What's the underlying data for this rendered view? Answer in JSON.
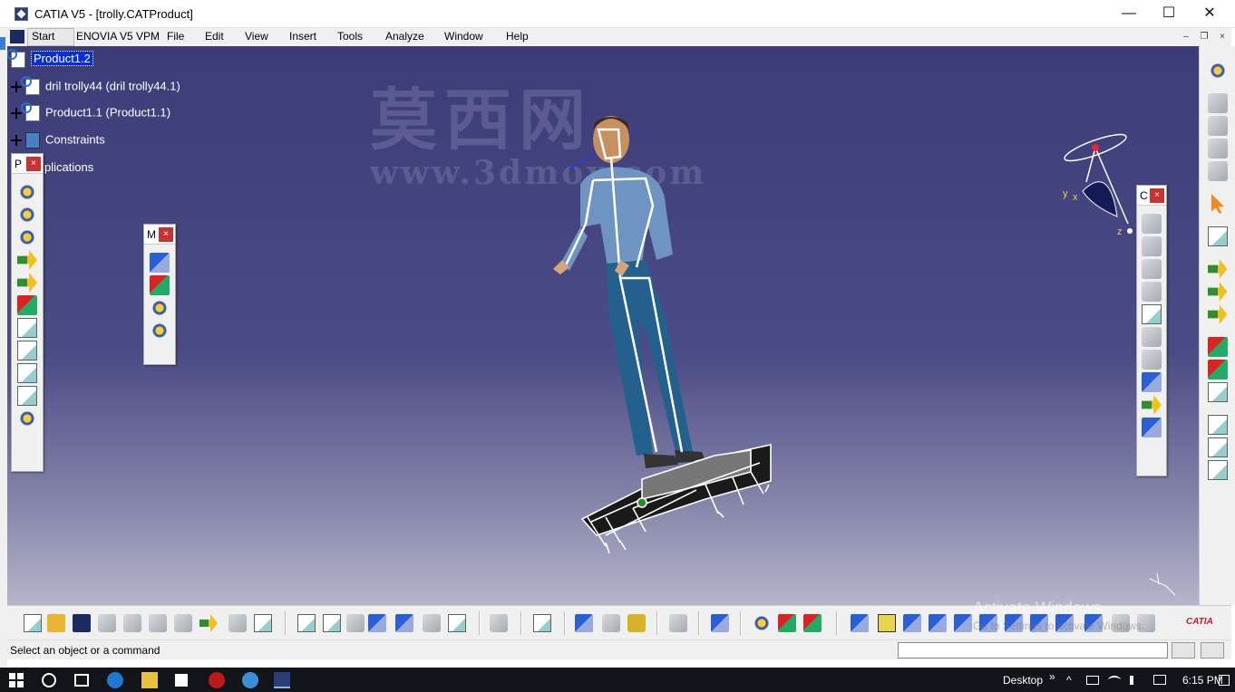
{
  "window": {
    "title": "CATIA V5 - [trolly.CATProduct]",
    "minimize_label": "—",
    "maximize_label": "☐",
    "close_label": "✕"
  },
  "menu": {
    "items": [
      "Start",
      "ENOVIA V5 VPM",
      "File",
      "Edit",
      "View",
      "Insert",
      "Tools",
      "Analyze",
      "Window",
      "Help"
    ],
    "mdi_minimize": "–",
    "mdi_restore": "❐",
    "mdi_close": "×"
  },
  "tree": {
    "root": "Product1.2",
    "children": [
      "dril trolly44 (dril trolly44.1)",
      "Product1.1 (Product1.1)",
      "Constraints",
      "plications"
    ]
  },
  "watermark": {
    "chinese": "莫西网",
    "url": "www.3dmox.com"
  },
  "compass": {
    "x": "x",
    "y": "y",
    "z": "z"
  },
  "floating_toolbars": {
    "left": {
      "title": "P",
      "close": "×"
    },
    "middle": {
      "title": "M",
      "close": "×"
    },
    "right": {
      "title": "C",
      "close": "×"
    }
  },
  "status": {
    "message": "Select an object or a command",
    "command_value": ""
  },
  "overlay": {
    "activate": "Activate Windows",
    "activate_sub": "Go to Settings to activate Windows."
  },
  "brand": {
    "logo_text": "CATIA"
  },
  "taskbar": {
    "desktop_label": "Desktop",
    "chevron": "»",
    "time": "6:15 PM"
  }
}
